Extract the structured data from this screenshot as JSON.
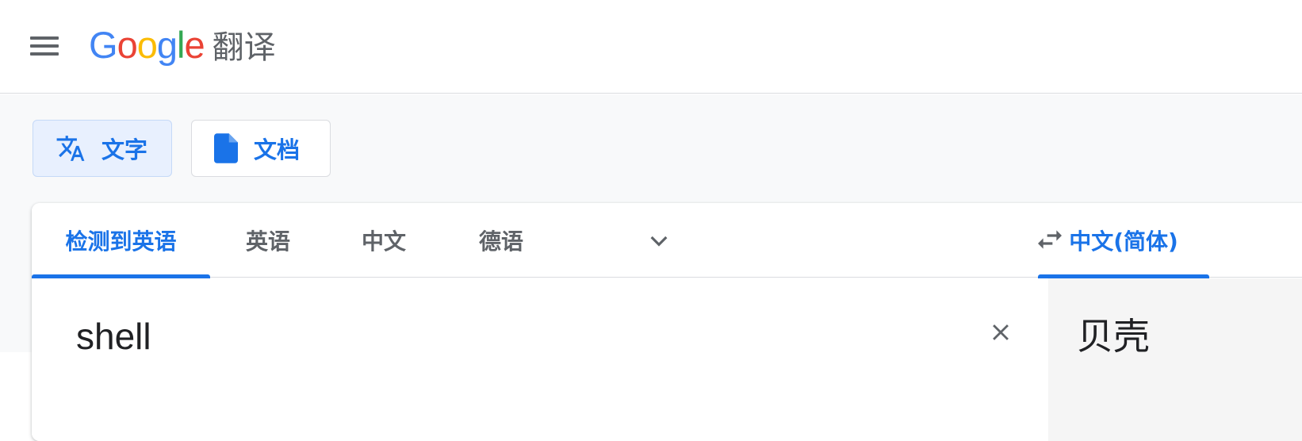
{
  "header": {
    "logo_letters": [
      {
        "ch": "G",
        "color": "#4285F4"
      },
      {
        "ch": "o",
        "color": "#EA4335"
      },
      {
        "ch": "o",
        "color": "#FBBC05"
      },
      {
        "ch": "g",
        "color": "#4285F4"
      },
      {
        "ch": "l",
        "color": "#34A853"
      },
      {
        "ch": "e",
        "color": "#EA4335"
      }
    ],
    "product_name": "翻译"
  },
  "modes": {
    "text_label": "文字",
    "doc_label": "文档"
  },
  "source_languages": {
    "detected": "检测到英语",
    "english": "英语",
    "chinese": "中文",
    "german": "德语"
  },
  "target_languages": {
    "selected": "中文(简体)"
  },
  "source": {
    "text": "shell"
  },
  "target": {
    "text": "贝壳"
  },
  "colors": {
    "accent": "#1a73e8",
    "icon_gray": "#5f6368"
  }
}
